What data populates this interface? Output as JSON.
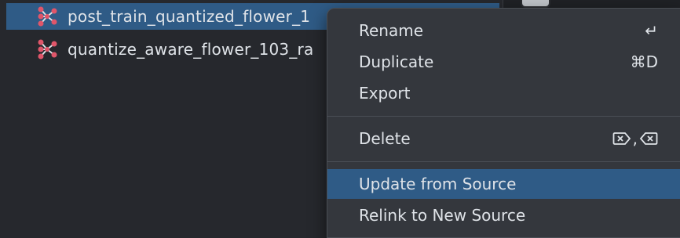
{
  "files": [
    {
      "name": "post_train_quantized_flower_1",
      "selected": true,
      "icon": "neural-network-icon"
    },
    {
      "name": "quantize_aware_flower_103_ra",
      "selected": false,
      "icon": "neural-network-icon"
    }
  ],
  "context_menu": {
    "items": [
      {
        "label": "Rename",
        "shortcut": "↵",
        "shortcut_icon": "return-key-icon"
      },
      {
        "label": "Duplicate",
        "shortcut": "⌘D",
        "shortcut_icon": "command-d-shortcut"
      },
      {
        "label": "Export",
        "shortcut": ""
      },
      {
        "label": "Delete",
        "shortcut": ",",
        "shortcut_icon": "delete-keys-icon"
      },
      {
        "label": "Update from Source",
        "shortcut": "",
        "highlighted": true
      },
      {
        "label": "Relink to New Source",
        "shortcut": ""
      }
    ]
  },
  "colors": {
    "selection": "#2f5b86",
    "menu_bg": "#34373d",
    "panel_bg": "#26282d",
    "text": "#dfe3e8",
    "icon_accent": "#e0566a"
  }
}
